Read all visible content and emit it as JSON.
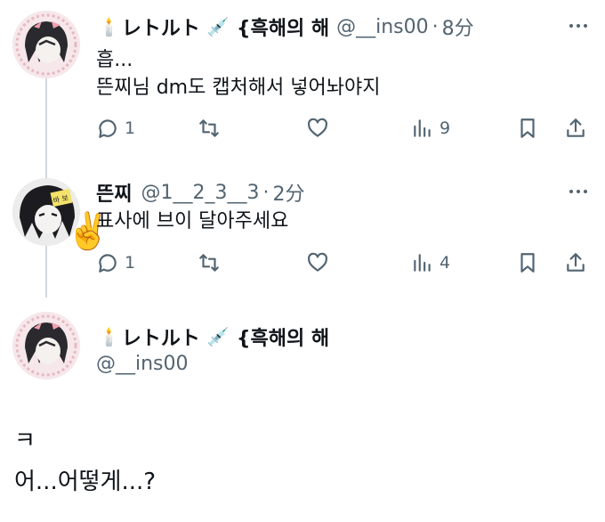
{
  "tweets": [
    {
      "display_name": "レトルト",
      "name_suffix": "{흑해의 해",
      "handle": "@__ins00",
      "separator": "·",
      "time": "8分",
      "lines": [
        "흡...",
        "뜬찌님 dm도 캡처해서 넣어놔야지"
      ],
      "actions": {
        "reply": "1",
        "views": "9"
      },
      "avatar": "anime-avatar-pink-frame"
    },
    {
      "display_name": "뜬찌",
      "handle": "@1__2_3__3",
      "separator": "·",
      "time": "2分",
      "lines": [
        "표사에 브이 달아주세요"
      ],
      "actions": {
        "reply": "1",
        "views": "4"
      },
      "avatar": "anime-avatar-dark",
      "avatar_tag": "바 보"
    }
  ],
  "focus_tweet": {
    "display_name": "レトルト",
    "name_suffix": "{흑해의 해",
    "handle": "@__ins00",
    "lines": [
      "ㅋ",
      "어...어떻게...?"
    ]
  },
  "colors": {
    "text": "#0f1419",
    "secondary": "#536471",
    "thread_line": "#cfd9de"
  }
}
